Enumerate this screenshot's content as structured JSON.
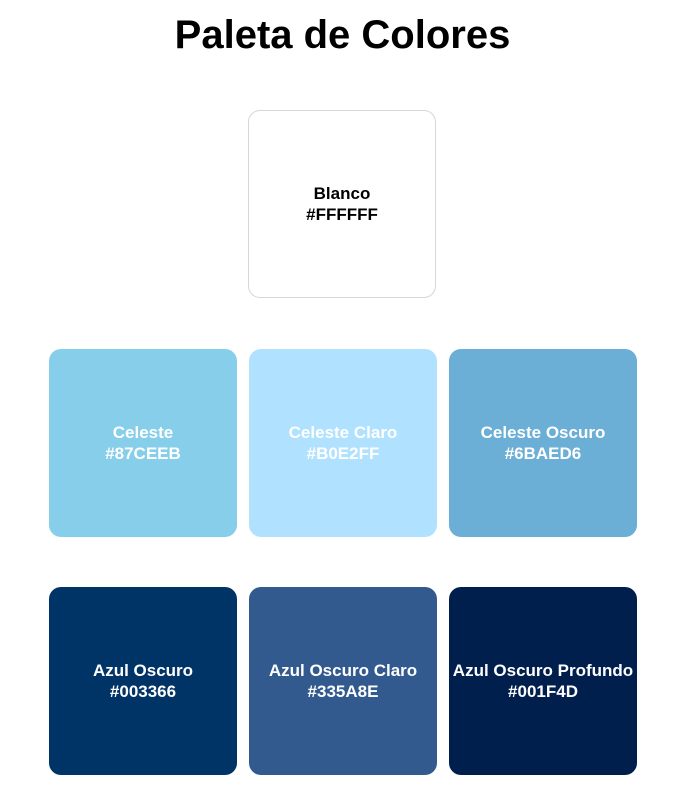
{
  "title": "Paleta de Colores",
  "colors": [
    {
      "name": "Blanco",
      "hex": "#FFFFFF",
      "text_color": "#000000"
    },
    {
      "name": "Celeste",
      "hex": "#87CEEB",
      "text_color": "#FFFFFF"
    },
    {
      "name": "Celeste Claro",
      "hex": "#B0E2FF",
      "text_color": "#FFFFFF"
    },
    {
      "name": "Celeste Oscuro",
      "hex": "#6BAED6",
      "text_color": "#FFFFFF"
    },
    {
      "name": "Azul Oscuro",
      "hex": "#003366",
      "text_color": "#FFFFFF"
    },
    {
      "name": "Azul Oscuro Claro",
      "hex": "#335A8E",
      "text_color": "#FFFFFF"
    },
    {
      "name": "Azul Oscuro Profundo",
      "hex": "#001F4D",
      "text_color": "#FFFFFF"
    }
  ]
}
